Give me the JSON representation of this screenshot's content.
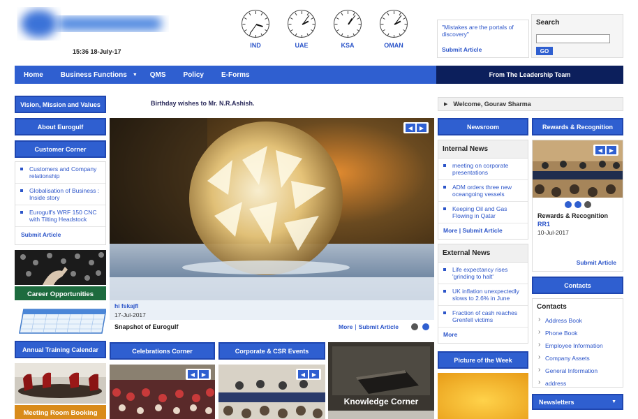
{
  "header": {
    "datetime": "15:36  18-July-17",
    "clocks": [
      {
        "label": "IND",
        "hour": 3,
        "minute": 36
      },
      {
        "label": "UAE",
        "hour": 2,
        "minute": 6
      },
      {
        "label": "KSA",
        "hour": 1,
        "minute": 6
      },
      {
        "label": "OMAN",
        "hour": 2,
        "minute": 6
      }
    ],
    "quote": "\"Mistakes are the portals of discovery\"",
    "quote_submit": "Submit Article",
    "search": {
      "title": "Search",
      "placeholder": "",
      "button": "GO"
    }
  },
  "nav": {
    "items": [
      "Home",
      "Business Functions",
      "QMS",
      "Policy",
      "E-Forms"
    ],
    "leadership": "From The Leadership Team"
  },
  "left": {
    "vision": "Vision, Mission and Values",
    "about": "About Eurogulf",
    "customer_corner": "Customer Corner",
    "customer_items": [
      "Customers and Company relationship",
      "Globalisation of Business : Inside story",
      "Eurogulf's WRF 150 CNC with Tilting Headstock"
    ],
    "submit": "Submit Article",
    "career": "Career Opportunities",
    "training": "Annual Training Calendar",
    "meeting": "Meeting Room Booking"
  },
  "center": {
    "birthday": "Birthday wishes to Mr. N.R.Ashish.",
    "slide_caption": "hi fskajfl",
    "slide_date": "17-Jul-2017",
    "snapshot": "Snapshot of Eurogulf",
    "more": "More",
    "submit": "Submit Article",
    "celebrations": "Celebrations Corner",
    "csr": "Corporate & CSR Events",
    "knowledge": "Knowledge Corner"
  },
  "news": {
    "title": "Newsroom",
    "internal_title": "Internal News",
    "internal": [
      "meeting on corporate presentations",
      "ADM orders three new oceangoing vessels",
      "Keeping Oil and Gas Flowing in Qatar"
    ],
    "more": "More",
    "submit": "Submit Article",
    "external_title": "External News",
    "external": [
      "Life expectancy rises 'grinding to halt'",
      "UK inflation unexpectedly slows to 2.6% in June",
      "Fraction of cash reaches Grenfell victims"
    ],
    "external_more": "More",
    "picture_week": "Picture of the Week"
  },
  "right": {
    "welcome": "Welcome, Gourav Sharma",
    "rewards_title": "Rewards & Recognition",
    "rewards_heading": "Rewards & Recognition",
    "rewards_sub": "RR1",
    "rewards_date": "10-Jul-2017",
    "rewards_submit": "Submit Article",
    "contacts_bar": "Contacts",
    "contacts_title": "Contacts",
    "contacts": [
      "Address Book",
      "Phone Book",
      "Employee Information",
      "Company Assets",
      "General Information",
      "address"
    ],
    "newsletters": "Newsletters"
  }
}
